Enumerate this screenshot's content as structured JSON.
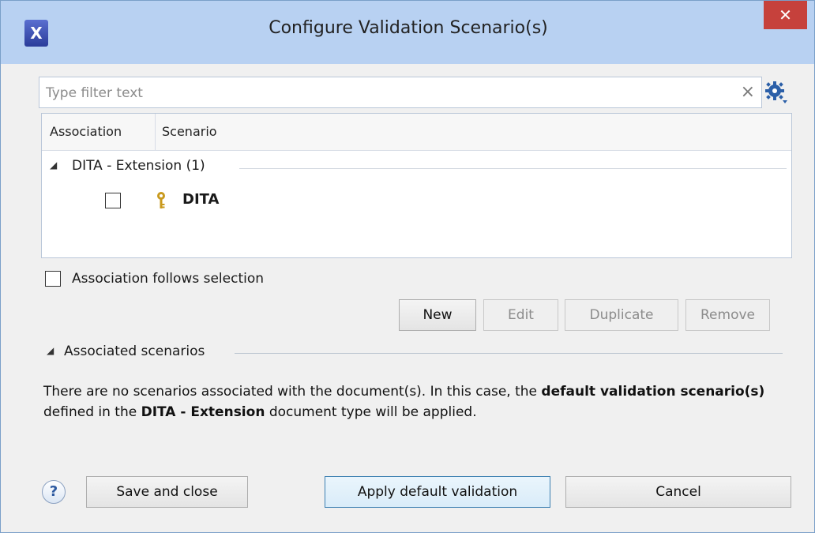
{
  "window": {
    "title": "Configure Validation Scenario(s)",
    "close_label": "✕"
  },
  "filter": {
    "placeholder": "Type filter text",
    "value": ""
  },
  "table": {
    "columns": [
      "Association",
      "Scenario"
    ],
    "group": {
      "label": "DITA - Extension (1)",
      "expanded": true
    },
    "items": [
      {
        "name": "DITA",
        "associated": false,
        "icon": "key-icon"
      }
    ]
  },
  "association_follows_selection": {
    "label": "Association follows selection",
    "checked": false
  },
  "buttons": {
    "new": "New",
    "edit": "Edit",
    "duplicate": "Duplicate",
    "remove": "Remove"
  },
  "associated_section": {
    "label": "Associated scenarios",
    "message_parts": {
      "p1": "There are no scenarios associated with the document(s). In this case, the ",
      "b1": "default validation scenario(s)",
      "p2": " defined in the ",
      "b2": "DITA - Extension",
      "p3": " document type will be applied."
    }
  },
  "footer": {
    "help": "?",
    "save_close": "Save and close",
    "apply_default": "Apply default validation",
    "cancel": "Cancel"
  },
  "colors": {
    "titlebar": "#b8d1f2",
    "close": "#c6413c",
    "primary_border": "#3c7fb1",
    "gear": "#2b5fa8",
    "key": "#c99a1e"
  }
}
